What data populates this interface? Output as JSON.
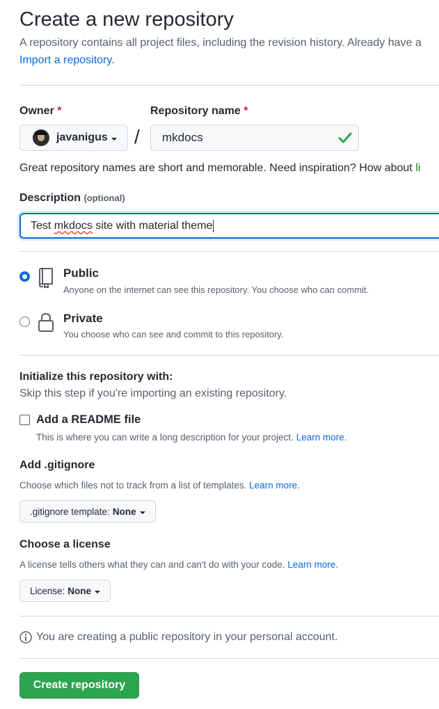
{
  "header": {
    "title": "Create a new repository",
    "subtitle": "A repository contains all project files, including the revision history. Already have a",
    "import_link": "Import a repository."
  },
  "owner": {
    "label": "Owner",
    "required_mark": "*",
    "value": "javanigus"
  },
  "repo_name": {
    "label": "Repository name",
    "required_mark": "*",
    "value": "mkdocs",
    "valid_icon": "check-icon"
  },
  "slash": "/",
  "hint": {
    "text": "Great repository names are short and memorable. Need inspiration? How about",
    "suggestion": "li"
  },
  "description": {
    "label": "Description",
    "optional": "(optional)",
    "value_misspelled": "mkdocs",
    "value_prefix": "Test ",
    "value_suffix": " site with material theme"
  },
  "visibility": {
    "public": {
      "title": "Public",
      "desc": "Anyone on the internet can see this repository. You choose who can commit.",
      "selected": true,
      "icon": "repo-icon"
    },
    "private": {
      "title": "Private",
      "desc": "You choose who can see and commit to this repository.",
      "selected": false,
      "icon": "lock-icon"
    }
  },
  "initialize": {
    "title": "Initialize this repository with:",
    "desc": "Skip this step if you're importing an existing repository.",
    "readme": {
      "label": "Add a README file",
      "desc": "This is where you can write a long description for your project.",
      "link": "Learn more.",
      "checked": false
    }
  },
  "gitignore": {
    "title": "Add .gitignore",
    "desc": "Choose which files not to track from a list of templates.",
    "link": "Learn more.",
    "select_label": ".gitignore template:",
    "select_value": "None"
  },
  "license": {
    "title": "Choose a license",
    "desc": "A license tells others what they can and can't do with your code.",
    "link": "Learn more.",
    "select_label": "License:",
    "select_value": "None"
  },
  "notice": {
    "text": "You are creating a public repository in your personal account.",
    "icon": "info-icon"
  },
  "create_button": "Create repository",
  "colors": {
    "primary_button": "#2da44e",
    "link": "#0969da",
    "required": "#cf222e",
    "focus": "#0969da",
    "success": "#1a7f37"
  }
}
